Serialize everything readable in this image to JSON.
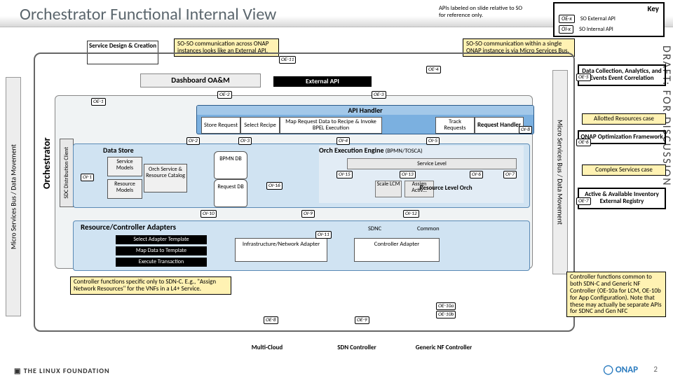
{
  "title": "Orchestrator Functional Internal View",
  "top_note": "APIs labeled on slide relative to SO for reference only.",
  "key": {
    "title": "Key",
    "oe": "OE-x",
    "oe_desc": "SO External API",
    "oi": "OI-x",
    "oi_desc": "SO Internal API"
  },
  "yellow": {
    "across": "SO-SO communication across ONAP instances looks like an External API.",
    "within": "SO-SO communication within a single ONAP instance is via Micro Services Bus.",
    "allotted": "Allotted Resources case",
    "complex": "Complex Services case",
    "ctrl_left": "Controller functions specific only to SDN-C. E.g., \"Assign Network Resources\" for the VNFs in a L4+ Service.",
    "ctrl_right": "Controller functions common to both SDN-C and Generic NF Controller (OE-10a for LCM, OE-10b for App Configuration). Note that these may actually be separate APIs for SDNC and Gen NFC"
  },
  "svc_design": "Service Design & Creation",
  "msb": "Micro Services Bus   /   Data Movement",
  "orchestrator": "Orchestrator",
  "sdc": "SDC Distribution Client",
  "dashoam": "Dashboard OA&M",
  "ext_api": "External API",
  "api_handler": {
    "title": "API Handler",
    "store": "Store Request",
    "select": "Select Recipe",
    "map": "Map Request Data to Recipe & Invoke BPEL Execution",
    "track": "Track Requests",
    "req": "Request Handler"
  },
  "data_store": {
    "title": "Data Store",
    "svc": "Service Models",
    "res": "Resource Models",
    "cat": "Orch Service & Resource Catalog",
    "bpmn": "BPMN DB",
    "reqdb": "Request DB"
  },
  "exec": {
    "title": "Orch Execution Engine",
    "paren": "(BPMN/TOSCA)",
    "svc_level": "Service Level",
    "scale": "Scale LCM",
    "assign": "Assign Activ…",
    "rlo": "Resource Level Orch"
  },
  "rca": {
    "title": "Resource/Controller Adapters",
    "sel": "Select Adapter Template",
    "map": "Map Data to Template",
    "exec": "Execute Transaction",
    "infra": "Infrastructure/Network Adapter",
    "ctrl": "Controller Adapter",
    "sdnc": "SDNC",
    "common": "Common"
  },
  "bottom": {
    "mc": "Multi-Cloud",
    "sdn": "SDN Controller",
    "gnf": "Generic NF Controller"
  },
  "right": {
    "dc": "Data Collection, Analytics, and Events Event Correlation",
    "opt": "ONAP Optimization Framework",
    "inv": "Active & Available Inventory External Registry"
  },
  "draft": "DRAFT: FOR DISCUSSION",
  "page": "2",
  "tags": {
    "oe1": "OE-1",
    "oe2": "OE-2",
    "oe3": "OE-3",
    "oe4": "OE-4",
    "oe5": "OE-5",
    "oe6": "OE-6",
    "oe7": "OE-7",
    "oe8": "OE-8",
    "oe9": "OE-9",
    "oe10a": "OE-10a",
    "oe10b": "OE-10b",
    "oe11": "OE-11",
    "oi1": "OI-1",
    "oi2": "OI-2",
    "oi3": "OI-3",
    "oi4": "OI-4",
    "oi5": "OI-5",
    "oi6": "OI-6",
    "oi7": "OI-7",
    "oi8": "OI-8",
    "oi9": "OI-9",
    "oi10": "OI-10",
    "oi11": "OI-11",
    "oi12": "OI-12",
    "oi13": "OI-13",
    "oi15": "OI-15",
    "oi16": "OI-16"
  }
}
